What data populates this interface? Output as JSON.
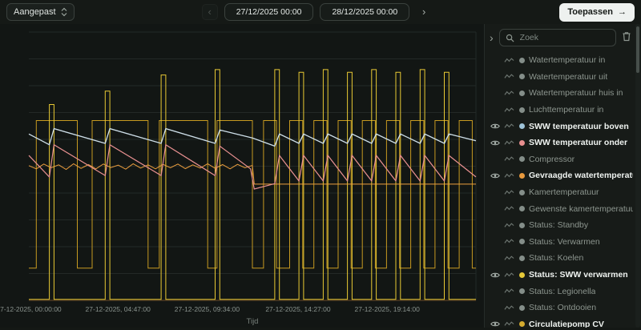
{
  "toolbar": {
    "preset_label": "Aangepast",
    "prev_label": "‹",
    "date_from": "27/12/2025 00:00",
    "date_to": "28/12/2025 00:00",
    "next_label": "›",
    "apply_label": "Toepassen",
    "apply_arrow": "→"
  },
  "sidebar": {
    "search_placeholder": "Zoek",
    "items": [
      {
        "label": "Watertemperatuur in",
        "color": "#848e89",
        "active": false
      },
      {
        "label": "Watertemperatuur uit",
        "color": "#848e89",
        "active": false
      },
      {
        "label": "Watertemperatuur huis in",
        "color": "#848e89",
        "active": false
      },
      {
        "label": "Luchttemperatuur in",
        "color": "#848e89",
        "active": false
      },
      {
        "label": "SWW temperatuur boven",
        "color": "#9ec3d8",
        "active": true
      },
      {
        "label": "SWW temperatuur onder",
        "color": "#e88f8f",
        "active": true
      },
      {
        "label": "Compressor",
        "color": "#848e89",
        "active": false
      },
      {
        "label": "Gevraagde watertemperatuur",
        "color": "#e8993d",
        "active": true
      },
      {
        "label": "Kamertemperatuur",
        "color": "#848e89",
        "active": false
      },
      {
        "label": "Gewenste kamertemperatuur",
        "color": "#848e89",
        "active": false
      },
      {
        "label": "Status: Standby",
        "color": "#848e89",
        "active": false
      },
      {
        "label": "Status: Verwarmen",
        "color": "#848e89",
        "active": false
      },
      {
        "label": "Status: Koelen",
        "color": "#848e89",
        "active": false
      },
      {
        "label": "Status: SWW verwarmen",
        "color": "#e5c838",
        "active": true
      },
      {
        "label": "Status: Legionella",
        "color": "#848e89",
        "active": false
      },
      {
        "label": "Status: Ontdooien",
        "color": "#848e89",
        "active": false
      },
      {
        "label": "Circulatiepomp CV",
        "color": "#d4ab2e",
        "active": true
      }
    ]
  },
  "chart_data": {
    "type": "line",
    "title": "",
    "xlabel": "Tijd",
    "ylabel": "",
    "x_range": [
      0,
      24
    ],
    "y_range": [
      0,
      100
    ],
    "grid": true,
    "gridline_values": [
      0,
      10,
      20,
      30,
      40,
      50,
      60,
      70,
      80,
      90,
      100
    ],
    "x_ticks": [
      {
        "pos": 0,
        "label": "27-12-2025, 00:00:00"
      },
      {
        "pos": 4.783,
        "label": "27-12-2025, 04:47:00"
      },
      {
        "pos": 9.567,
        "label": "27-12-2025, 09:34:00"
      },
      {
        "pos": 14.45,
        "label": "27-12-2025, 14:27:00"
      },
      {
        "pos": 19.233,
        "label": "27-12-2025, 19:14:00"
      }
    ],
    "axis_color": "#6b4a28",
    "grid_color": "#232927",
    "series": [
      {
        "name": "Circulatiepomp CV",
        "color": "#c79a21",
        "width": 1,
        "points": [
          [
            0,
            12
          ],
          [
            0.4,
            12
          ],
          [
            0.4,
            67
          ],
          [
            2.6,
            67
          ],
          [
            2.6,
            12
          ],
          [
            3.4,
            12
          ],
          [
            3.4,
            67
          ],
          [
            6.4,
            67
          ],
          [
            6.4,
            12
          ],
          [
            7.0,
            12
          ],
          [
            7.0,
            67
          ],
          [
            9.6,
            67
          ],
          [
            9.6,
            12
          ],
          [
            10.1,
            12
          ],
          [
            10.1,
            67
          ],
          [
            12.0,
            67
          ],
          [
            12.0,
            12
          ],
          [
            12.6,
            12
          ],
          [
            12.6,
            67
          ],
          [
            13.3,
            67
          ],
          [
            13.3,
            12
          ],
          [
            14.0,
            12
          ],
          [
            14.0,
            67
          ],
          [
            14.7,
            67
          ],
          [
            14.7,
            12
          ],
          [
            15.3,
            12
          ],
          [
            15.3,
            67
          ],
          [
            16.0,
            67
          ],
          [
            16.0,
            12
          ],
          [
            16.6,
            12
          ],
          [
            16.6,
            67
          ],
          [
            17.3,
            67
          ],
          [
            17.3,
            12
          ],
          [
            17.9,
            12
          ],
          [
            17.9,
            67
          ],
          [
            18.6,
            67
          ],
          [
            18.6,
            12
          ],
          [
            19.2,
            12
          ],
          [
            19.2,
            67
          ],
          [
            19.9,
            67
          ],
          [
            19.9,
            12
          ],
          [
            20.5,
            12
          ],
          [
            20.5,
            67
          ],
          [
            21.2,
            67
          ],
          [
            21.2,
            12
          ],
          [
            21.8,
            12
          ],
          [
            21.8,
            67
          ],
          [
            22.5,
            67
          ],
          [
            22.5,
            12
          ],
          [
            23.1,
            12
          ],
          [
            23.1,
            67
          ],
          [
            23.8,
            67
          ],
          [
            23.8,
            12
          ],
          [
            24,
            12
          ]
        ]
      },
      {
        "name": "Status: SWW verwarmen",
        "color": "#e8c934",
        "width": 1,
        "points": [
          [
            0,
            0.4
          ],
          [
            1.1,
            0.4
          ],
          [
            1.1,
            73
          ],
          [
            1.35,
            73
          ],
          [
            1.35,
            0.4
          ],
          [
            4.1,
            0.4
          ],
          [
            4.1,
            78
          ],
          [
            4.35,
            78
          ],
          [
            4.35,
            0.4
          ],
          [
            7.1,
            0.4
          ],
          [
            7.1,
            84
          ],
          [
            7.35,
            84
          ],
          [
            7.35,
            0.4
          ],
          [
            10.0,
            0.4
          ],
          [
            10.0,
            86
          ],
          [
            10.25,
            86
          ],
          [
            10.25,
            0.4
          ],
          [
            13.2,
            0.4
          ],
          [
            13.2,
            86
          ],
          [
            13.45,
            86
          ],
          [
            13.45,
            0.4
          ],
          [
            14.5,
            0.4
          ],
          [
            14.5,
            85
          ],
          [
            14.75,
            85
          ],
          [
            14.75,
            0.4
          ],
          [
            15.8,
            0.4
          ],
          [
            15.8,
            86
          ],
          [
            16.05,
            86
          ],
          [
            16.05,
            0.4
          ],
          [
            17.1,
            0.4
          ],
          [
            17.1,
            85
          ],
          [
            17.35,
            85
          ],
          [
            17.35,
            0.4
          ],
          [
            18.4,
            0.4
          ],
          [
            18.4,
            86
          ],
          [
            18.65,
            86
          ],
          [
            18.65,
            0.4
          ],
          [
            19.7,
            0.4
          ],
          [
            19.7,
            85
          ],
          [
            19.95,
            85
          ],
          [
            19.95,
            0.4
          ],
          [
            21.0,
            0.4
          ],
          [
            21.0,
            86
          ],
          [
            21.25,
            86
          ],
          [
            21.25,
            0.4
          ],
          [
            22.3,
            0.4
          ],
          [
            22.3,
            85
          ],
          [
            22.55,
            85
          ],
          [
            22.55,
            0.4
          ],
          [
            24,
            0.4
          ]
        ]
      },
      {
        "name": "Gevraagde watertemperatuur",
        "color": "#ed9f3e",
        "width": 1,
        "points": [
          [
            0,
            50.2
          ],
          [
            0.4,
            49.0
          ],
          [
            0.8,
            50.8
          ],
          [
            1.2,
            49.4
          ],
          [
            1.6,
            50.5
          ],
          [
            2.0,
            48.8
          ],
          [
            2.4,
            50.9
          ],
          [
            2.8,
            49.2
          ],
          [
            3.2,
            50.6
          ],
          [
            3.6,
            49.0
          ],
          [
            4.0,
            50.8
          ],
          [
            4.4,
            49.5
          ],
          [
            4.8,
            50.4
          ],
          [
            5.2,
            48.9
          ],
          [
            5.6,
            50.9
          ],
          [
            6.0,
            49.3
          ],
          [
            6.4,
            50.5
          ],
          [
            6.8,
            49.0
          ],
          [
            7.2,
            50.7
          ],
          [
            7.6,
            49.4
          ],
          [
            8.0,
            50.8
          ],
          [
            8.4,
            49.1
          ],
          [
            8.8,
            50.5
          ],
          [
            9.2,
            49.3
          ],
          [
            9.6,
            50.9
          ],
          [
            10.0,
            49.2
          ],
          [
            10.4,
            50.6
          ],
          [
            10.8,
            49.0
          ],
          [
            11.2,
            50.7
          ],
          [
            11.6,
            49.4
          ],
          [
            12.0,
            50.3
          ],
          [
            12.1,
            43.3
          ],
          [
            24,
            43.3
          ]
        ]
      },
      {
        "name": "SWW temperatuur onder",
        "color": "#e99191",
        "width": 1.2,
        "points": [
          [
            0,
            54
          ],
          [
            1.1,
            46
          ],
          [
            1.35,
            58
          ],
          [
            4.1,
            46.5
          ],
          [
            4.35,
            58
          ],
          [
            7.1,
            46.5
          ],
          [
            7.35,
            58
          ],
          [
            10.0,
            46.5
          ],
          [
            10.25,
            57.5
          ],
          [
            11.9,
            49
          ],
          [
            12.1,
            41.5
          ],
          [
            13.2,
            43.5
          ],
          [
            13.45,
            54
          ],
          [
            14.5,
            44.5
          ],
          [
            14.75,
            54
          ],
          [
            15.8,
            44.5
          ],
          [
            16.05,
            54
          ],
          [
            17.1,
            44.5
          ],
          [
            17.35,
            54
          ],
          [
            18.4,
            44.5
          ],
          [
            18.65,
            54
          ],
          [
            19.7,
            44.5
          ],
          [
            19.95,
            54
          ],
          [
            21.0,
            44.5
          ],
          [
            21.25,
            54
          ],
          [
            22.3,
            44.5
          ],
          [
            22.55,
            54
          ],
          [
            24,
            46
          ]
        ]
      },
      {
        "name": "SWW temperatuur boven",
        "color": "#cfe0ea",
        "width": 1.3,
        "points": [
          [
            0,
            62
          ],
          [
            1.1,
            58
          ],
          [
            1.35,
            64
          ],
          [
            4.1,
            58.5
          ],
          [
            4.35,
            64
          ],
          [
            7.1,
            58.5
          ],
          [
            7.35,
            64
          ],
          [
            10.0,
            58.5
          ],
          [
            10.25,
            63.5
          ],
          [
            12.0,
            60.5
          ],
          [
            13.2,
            57.5
          ],
          [
            13.45,
            62
          ],
          [
            14.5,
            58.5
          ],
          [
            14.75,
            62
          ],
          [
            15.8,
            58.5
          ],
          [
            16.05,
            62
          ],
          [
            17.1,
            58.5
          ],
          [
            17.35,
            62
          ],
          [
            18.4,
            58.5
          ],
          [
            18.65,
            62
          ],
          [
            19.7,
            58.5
          ],
          [
            19.95,
            62
          ],
          [
            21.0,
            58.5
          ],
          [
            21.25,
            62
          ],
          [
            22.3,
            58.5
          ],
          [
            22.55,
            62
          ],
          [
            24,
            59.5
          ]
        ]
      }
    ]
  }
}
